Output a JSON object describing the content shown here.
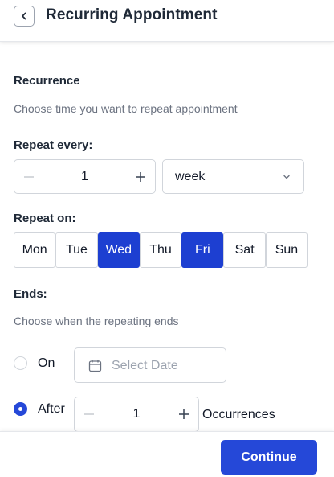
{
  "header": {
    "title": "Recurring Appointment",
    "back_icon": "chevron-left-icon"
  },
  "recurrence": {
    "title": "Recurrence",
    "description": "Choose time you want to repeat appointment"
  },
  "repeat_every": {
    "label": "Repeat every:",
    "value": "1",
    "unit": "week",
    "decrement_icon": "minus-icon",
    "increment_icon": "plus-icon",
    "dropdown_icon": "chevron-down-icon"
  },
  "repeat_on": {
    "label": "Repeat on:",
    "days": [
      {
        "label": "Mon",
        "selected": false
      },
      {
        "label": "Tue",
        "selected": false
      },
      {
        "label": "Wed",
        "selected": true
      },
      {
        "label": "Thu",
        "selected": false
      },
      {
        "label": "Fri",
        "selected": true
      },
      {
        "label": "Sat",
        "selected": false
      },
      {
        "label": "Sun",
        "selected": false
      }
    ]
  },
  "ends": {
    "label": "Ends:",
    "description": "Choose when the repeating ends",
    "on_option": {
      "label": "On",
      "selected": false,
      "date_placeholder": "Select Date",
      "calendar_icon": "calendar-icon"
    },
    "after_option": {
      "label": "After",
      "selected": true,
      "value": "1",
      "unit_label": "Occurrences"
    }
  },
  "footer": {
    "continue_label": "Continue"
  },
  "colors": {
    "primary": "#2548d8",
    "selected_day": "#1d3fd1",
    "muted_text": "#6b7280",
    "border": "#d1d5db"
  }
}
